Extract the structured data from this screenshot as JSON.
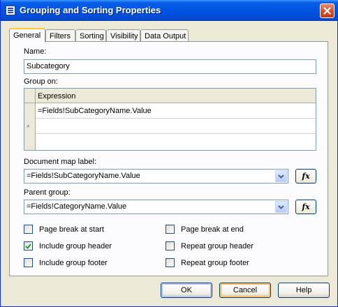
{
  "window": {
    "title": "Grouping and Sorting Properties",
    "title_icon": "dialog-properties-icon",
    "close_icon": "close-icon"
  },
  "tabs": [
    {
      "label": "General",
      "active": true
    },
    {
      "label": "Filters",
      "active": false
    },
    {
      "label": "Sorting",
      "active": false
    },
    {
      "label": "Visibility",
      "active": false
    },
    {
      "label": "Data Output",
      "active": false
    }
  ],
  "general": {
    "name_label": "Name:",
    "name_value": "Subcategory",
    "group_on_label": "Group on:",
    "group_on": {
      "column_header": "Expression",
      "rows": [
        "=Fields!SubCategoryName.Value"
      ],
      "new_row_marker": "*"
    },
    "doc_map_label": "Document map label:",
    "doc_map_value": "=Fields!SubCategoryName.Value",
    "parent_group_label": "Parent group:",
    "parent_group_value": "=Fields!CategoryName.Value",
    "fx_label": "fx",
    "checkboxes": {
      "page_break_start": {
        "label": "Page break at start",
        "checked": false
      },
      "page_break_end": {
        "label": "Page break at end",
        "checked": false
      },
      "include_group_header": {
        "label": "Include group header",
        "checked": true
      },
      "repeat_group_header": {
        "label": "Repeat group header",
        "checked": false
      },
      "include_group_footer": {
        "label": "Include group footer",
        "checked": false
      },
      "repeat_group_footer": {
        "label": "Repeat group footer",
        "checked": false
      }
    }
  },
  "buttons": {
    "ok": "OK",
    "cancel": "Cancel",
    "help": "Help"
  },
  "colors": {
    "titlebar": "#0054e3",
    "dialog_face": "#ece9d8",
    "close_button": "#d44a27",
    "active_tab_highlight": "#ffc83c"
  }
}
